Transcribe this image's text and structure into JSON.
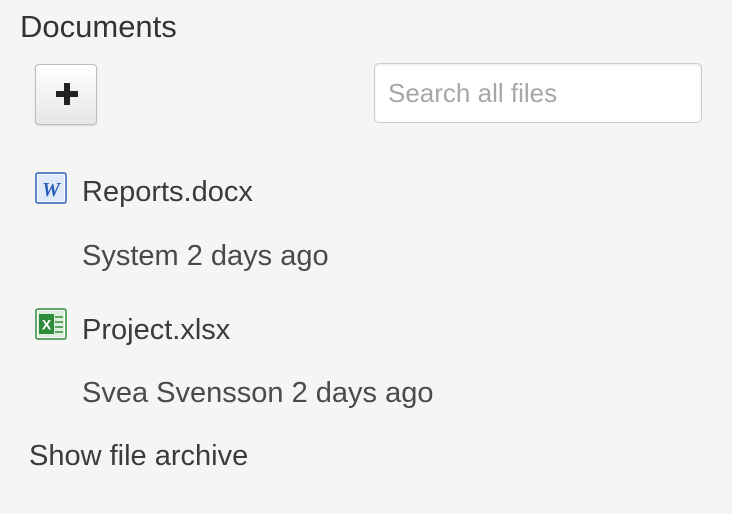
{
  "panel": {
    "title": "Documents",
    "add_button_icon": "plus-icon"
  },
  "search": {
    "placeholder": "Search all files",
    "value": ""
  },
  "files": [
    {
      "name": "Reports.docx",
      "icon": "word-document-icon",
      "author": "System",
      "modified": "2 days ago",
      "meta": "System 2 days ago",
      "icon_color": "#2b5eb8"
    },
    {
      "name": "Project.xlsx",
      "icon": "excel-spreadsheet-icon",
      "author": "Svea Svensson",
      "modified": "2 days ago",
      "meta": "Svea Svensson 2 days ago",
      "icon_color": "#2e8b3a"
    }
  ],
  "archive_link": "Show file archive"
}
